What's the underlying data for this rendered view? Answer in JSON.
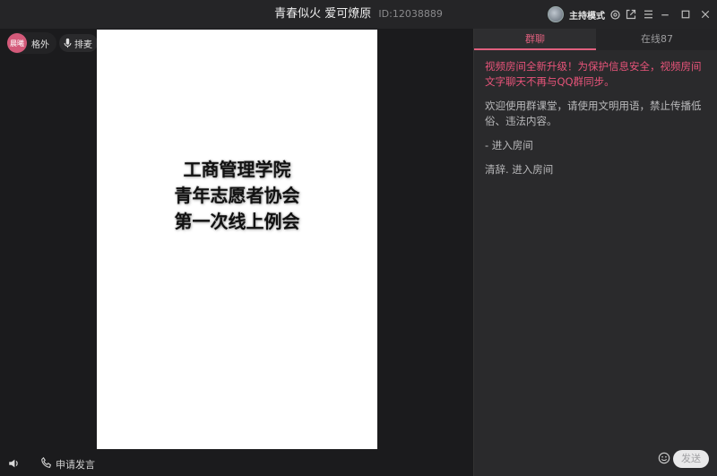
{
  "window": {
    "title": "青春似火 爱可燎原",
    "room_id": "ID:12038889",
    "host_mode_label": "主持模式"
  },
  "left": {
    "user": {
      "avatar_text": "晨曦",
      "name": "格外"
    },
    "mic_queue_label": "排麦",
    "slide_lines": [
      "工商管理学院",
      "青年志愿者协会",
      "第一次线上例会"
    ],
    "apply_speak_label": "申请发言"
  },
  "chat": {
    "tabs": [
      {
        "label": "群聊",
        "active": true
      },
      {
        "label": "在线87",
        "active": false
      }
    ],
    "messages": [
      {
        "type": "notice",
        "text": "视频房间全新升级！为保护信息安全，视频房间文字聊天不再与QQ群同步。"
      },
      {
        "type": "normal",
        "text": "欢迎使用群课堂，请使用文明用语，禁止传播低俗、违法内容。"
      },
      {
        "type": "normal",
        "text": "- 进入房间"
      },
      {
        "type": "normal",
        "text": "清辞. 进入房间"
      }
    ],
    "input_placeholder": "",
    "send_label": "发送"
  },
  "colors": {
    "accent": "#e0607e",
    "notice": "#e8547a",
    "panel_bg": "#2a2a2c",
    "bg": "#1b1b1d"
  },
  "icons": [
    "settings-icon",
    "popout-icon",
    "menu-icon",
    "minimize-icon",
    "maximize-icon",
    "close-icon",
    "microphone-icon",
    "speaker-icon",
    "phone-icon",
    "emoji-icon"
  ]
}
